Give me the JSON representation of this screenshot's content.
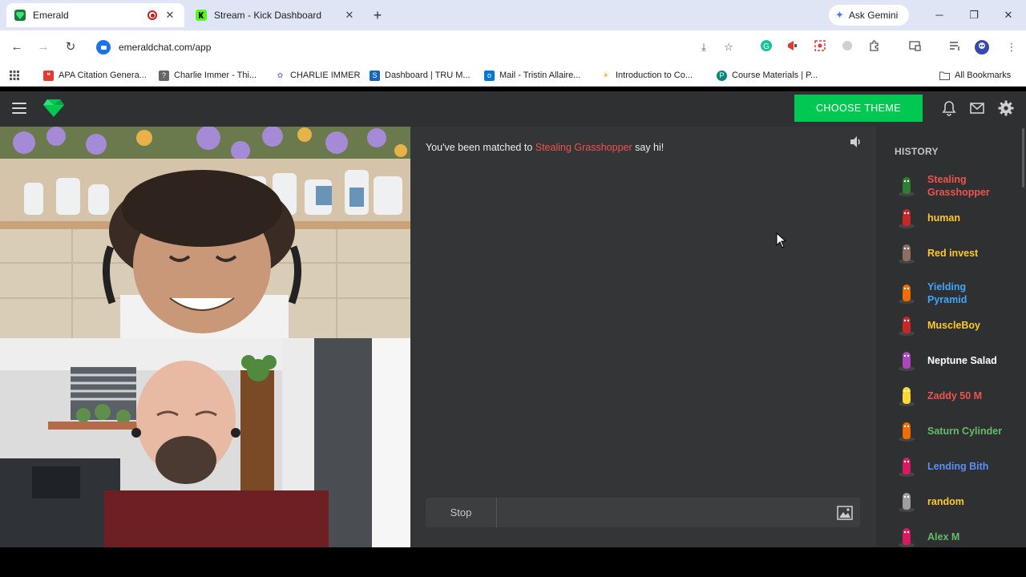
{
  "browser": {
    "tabs": [
      {
        "title": "Emerald",
        "active": true,
        "recording": true
      },
      {
        "title": "Stream - Kick Dashboard",
        "active": false
      }
    ],
    "ask_gemini": "Ask Gemini",
    "url": "emeraldchat.com/app",
    "bookmarks": [
      {
        "label": "APA Citation Genera..."
      },
      {
        "label": "Charlie Immer - Thi..."
      },
      {
        "label": "CHARLIE IMMER"
      },
      {
        "label": "Dashboard | TRU M..."
      },
      {
        "label": "Mail - Tristin Allaire..."
      },
      {
        "label": "Introduction to Co..."
      },
      {
        "label": "Course Materials | P..."
      }
    ],
    "all_bookmarks": "All Bookmarks"
  },
  "app": {
    "theme_button": "CHOOSE THEME",
    "brand_color": "#00c853",
    "match": {
      "prefix": "You've been matched to ",
      "name": "Stealing Grasshopper",
      "suffix": " say hi!"
    },
    "stop_label": "Stop",
    "chat_input": {
      "value": "",
      "placeholder": ""
    },
    "history": {
      "title": "HISTORY",
      "items": [
        {
          "name": "Stealing Grasshopper",
          "color": "#ef5350",
          "avatar": "#2e7d32"
        },
        {
          "name": "human",
          "color": "#ffca28",
          "avatar": "#c62828"
        },
        {
          "name": "Red invest",
          "color": "#ffca28",
          "avatar": "#8d6e63"
        },
        {
          "name": "Yielding Pyramid",
          "color": "#42a5f5",
          "avatar": "#ef6c00"
        },
        {
          "name": "MuscleBoy",
          "color": "#ffca28",
          "avatar": "#c62828"
        },
        {
          "name": "Neptune Salad",
          "color": "#ffffff",
          "avatar": "#ab47bc"
        },
        {
          "name": "Zaddy 50 M",
          "color": "#ef5350",
          "avatar": "#fdd835"
        },
        {
          "name": "Saturn Cylinder",
          "color": "#66bb6a",
          "avatar": "#ef6c00"
        },
        {
          "name": "Lending Bith",
          "color": "#5c8df6",
          "avatar": "#d81b60"
        },
        {
          "name": "random",
          "color": "#ffca28",
          "avatar": "#9e9e9e"
        },
        {
          "name": "Alex M",
          "color": "#66bb6a",
          "avatar": "#d81b60"
        }
      ]
    }
  }
}
